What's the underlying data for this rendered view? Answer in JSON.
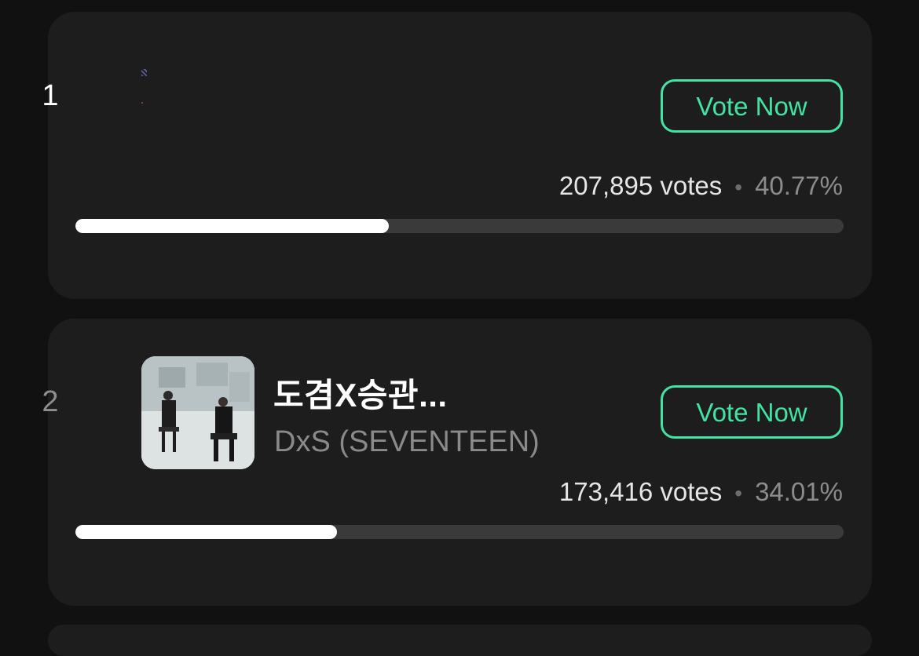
{
  "entries": [
    {
      "rank": "1",
      "title": "",
      "artist": "",
      "vote_button_label": "Vote Now",
      "votes_text": "207,895 votes",
      "separator": "•",
      "percent_text": "40.77%",
      "progress": 0.4077
    },
    {
      "rank": "2",
      "title": "도겸X승관...",
      "artist": "DxS (SEVENTEEN)",
      "vote_button_label": "Vote Now",
      "votes_text": "173,416 votes",
      "separator": "•",
      "percent_text": "34.01%",
      "progress": 0.3401
    }
  ],
  "colors": {
    "accent": "#43e3a3",
    "background": "#111111",
    "card": "#1d1d1d",
    "bar_track": "#3a3a3a",
    "bar_fill": "#ffffff"
  }
}
